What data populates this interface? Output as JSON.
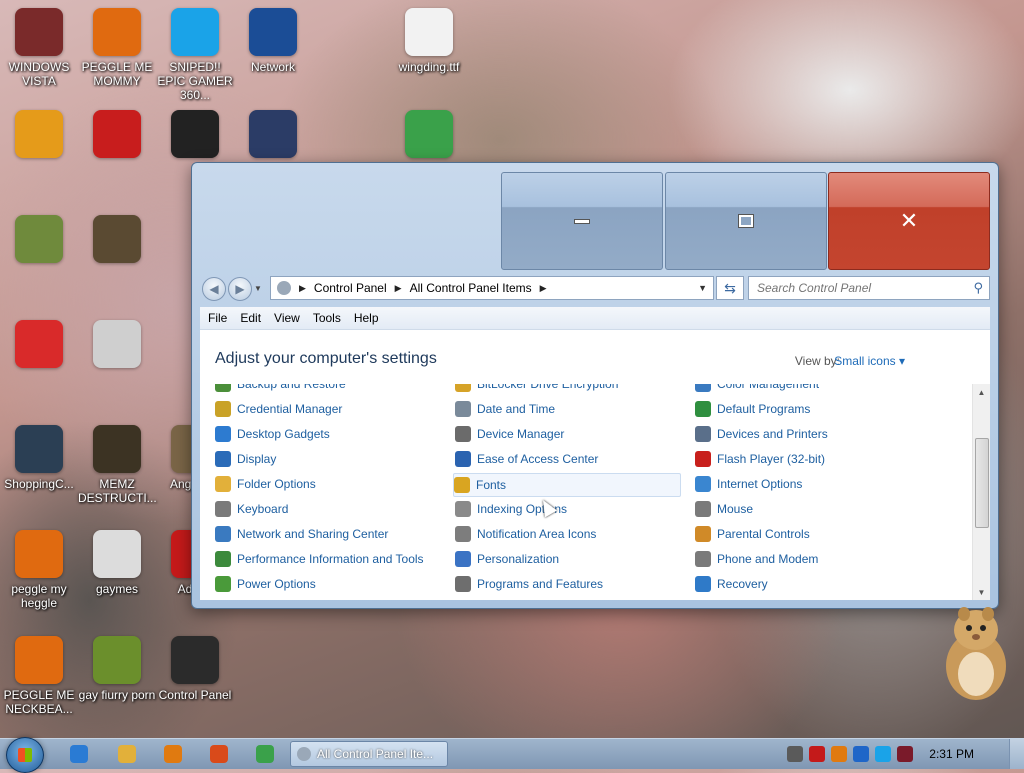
{
  "desktop_icons": [
    {
      "label": "WINDOWS VISTA",
      "color": "#7a2a2a"
    },
    {
      "label": "PEGGLE ME MOMMY",
      "color": "#e06a10"
    },
    {
      "label": "SNIPED!! EPIC GAMER 360...",
      "color": "#1aa3e8"
    },
    {
      "label": "Network",
      "color": "#1b4d96"
    },
    {
      "label": "wingding.ttf",
      "color": "#f2f2f2"
    },
    {
      "label": "",
      "color": "#e59b1a"
    },
    {
      "label": "",
      "color": "#c81d1d"
    },
    {
      "label": "",
      "color": "#222222"
    },
    {
      "label": "",
      "color": "#2b3c66"
    },
    {
      "label": "",
      "color": "#3aa14a"
    },
    {
      "label": "",
      "color": "#6f8a3c"
    },
    {
      "label": "",
      "color": "#5a4a32"
    },
    {
      "label": "",
      "color": "#d92a2a"
    },
    {
      "label": "",
      "color": "#cfcfcf"
    },
    {
      "label": "ShoppingC...",
      "color": "#2b3f54"
    },
    {
      "label": "MEMZ DESTRUCTI...",
      "color": "#3c3323"
    },
    {
      "label": "Angr Sea",
      "color": "#7a6547"
    },
    {
      "label": "peggle my heggle",
      "color": "#e06a10"
    },
    {
      "label": "gaymes",
      "color": "#dcdcdc"
    },
    {
      "label": "Adobe",
      "color": "#c51a1a"
    },
    {
      "label": "PEGGLE ME NECKBEA...",
      "color": "#e06a10"
    },
    {
      "label": "gay fiurry porn",
      "color": "#6b8f2c"
    },
    {
      "label": "Control Panel",
      "color": "#2b2b2b"
    }
  ],
  "window": {
    "address": {
      "crumbs": [
        "Control Panel",
        "All Control Panel Items"
      ]
    },
    "search_placeholder": "Search Control Panel",
    "menu": [
      "File",
      "Edit",
      "View",
      "Tools",
      "Help"
    ],
    "heading": "Adjust your computer's settings",
    "view_by_label": "View by:",
    "view_by_value": "Small icons ▾",
    "items": {
      "col1": [
        {
          "label": "Backup and Restore",
          "icon": "backup-icon",
          "color": "#4b8f3a"
        },
        {
          "label": "Credential Manager",
          "icon": "credential-icon",
          "color": "#c9a227"
        },
        {
          "label": "Desktop Gadgets",
          "icon": "gadgets-icon",
          "color": "#2d7bd0"
        },
        {
          "label": "Display",
          "icon": "display-icon",
          "color": "#2a6bb8"
        },
        {
          "label": "Folder Options",
          "icon": "folder-icon",
          "color": "#e2b03a"
        },
        {
          "label": "Keyboard",
          "icon": "keyboard-icon",
          "color": "#7a7a7a"
        },
        {
          "label": "Network and Sharing Center",
          "icon": "network-icon",
          "color": "#3a7ac0"
        },
        {
          "label": "Performance Information and Tools",
          "icon": "performance-icon",
          "color": "#3c8a3c"
        },
        {
          "label": "Power Options",
          "icon": "power-icon",
          "color": "#4a9a3a"
        }
      ],
      "col2": [
        {
          "label": "BitLocker Drive Encryption",
          "icon": "bitlocker-icon",
          "color": "#d6a328"
        },
        {
          "label": "Date and Time",
          "icon": "clock-icon",
          "color": "#7a8a9a"
        },
        {
          "label": "Device Manager",
          "icon": "device-manager-icon",
          "color": "#6b6b6b"
        },
        {
          "label": "Ease of Access Center",
          "icon": "ease-access-icon",
          "color": "#2b63b0"
        },
        {
          "label": "Fonts",
          "icon": "fonts-icon",
          "color": "#d9a521"
        },
        {
          "label": "Indexing Options",
          "icon": "indexing-icon",
          "color": "#8a8a8a"
        },
        {
          "label": "Notification Area Icons",
          "icon": "notification-icon",
          "color": "#7d7d7d"
        },
        {
          "label": "Personalization",
          "icon": "personalization-icon",
          "color": "#3b73c4"
        },
        {
          "label": "Programs and Features",
          "icon": "programs-icon",
          "color": "#6e6e6e"
        }
      ],
      "col3": [
        {
          "label": "Color Management",
          "icon": "color-mgmt-icon",
          "color": "#3a7ac0"
        },
        {
          "label": "Default Programs",
          "icon": "default-programs-icon",
          "color": "#2f8f3f"
        },
        {
          "label": "Devices and Printers",
          "icon": "printer-icon",
          "color": "#5a6f8a"
        },
        {
          "label": "Flash Player (32-bit)",
          "icon": "flash-icon",
          "color": "#c8201c"
        },
        {
          "label": "Internet Options",
          "icon": "internet-icon",
          "color": "#3a86d0"
        },
        {
          "label": "Mouse",
          "icon": "mouse-icon",
          "color": "#7a7a7a"
        },
        {
          "label": "Parental Controls",
          "icon": "parental-icon",
          "color": "#d08a28"
        },
        {
          "label": "Phone and Modem",
          "icon": "phone-icon",
          "color": "#7a7a7a"
        },
        {
          "label": "Recovery",
          "icon": "recovery-icon",
          "color": "#2f7ac8"
        }
      ]
    }
  },
  "taskbar": {
    "task_label": "All Control Panel Ite...",
    "clock": "2:31 PM",
    "pinned": [
      {
        "icon": "ie-icon",
        "color": "#2a7bd4"
      },
      {
        "icon": "explorer-icon",
        "color": "#e2b03a"
      },
      {
        "icon": "media-player-icon",
        "color": "#e07a10"
      },
      {
        "icon": "paint-icon",
        "color": "#d94a1a"
      },
      {
        "icon": "chrome-icon",
        "color": "#3aa14a"
      }
    ],
    "tray": [
      {
        "icon": "tray-app-icon",
        "color": "#5a5a5a"
      },
      {
        "icon": "tray-antivirus-icon",
        "color": "#c41a1a"
      },
      {
        "icon": "tray-search-icon",
        "color": "#e07a10"
      },
      {
        "icon": "tray-notes-icon",
        "color": "#1f66c8"
      },
      {
        "icon": "tray-display-icon",
        "color": "#1aa3e8"
      },
      {
        "icon": "tray-media-icon",
        "color": "#7a1a2a"
      }
    ]
  }
}
